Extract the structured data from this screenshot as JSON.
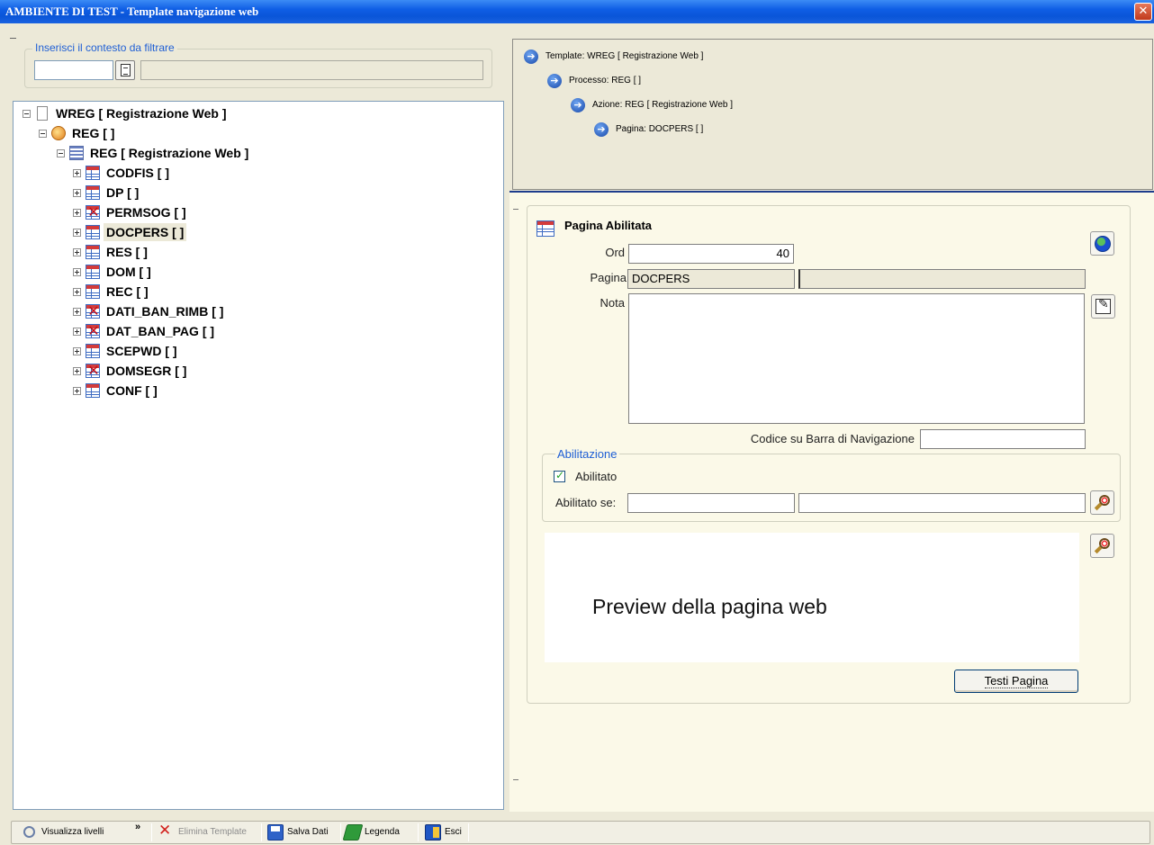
{
  "window": {
    "title": "AMBIENTE DI TEST - Template navigazione web",
    "close_glyph": "✕"
  },
  "filter": {
    "legend": "Inserisci il contesto da filtrare",
    "input_value": "",
    "description_value": ""
  },
  "tree": [
    {
      "label": "WREG  [ Registrazione Web ]",
      "icon": "document-icon",
      "expander": "minus"
    },
    {
      "label": "REG  [ ]",
      "icon": "process-icon",
      "expander": "minus"
    },
    {
      "label": "REG  [ Registrazione Web ]",
      "icon": "action-icon",
      "expander": "minus"
    },
    {
      "label": "CODFIS  [ ]",
      "icon": "table-icon",
      "expander": "plus"
    },
    {
      "label": "DP  [ ]",
      "icon": "table-icon",
      "expander": "plus"
    },
    {
      "label": "PERMSOG  [ ]",
      "icon": "table-disabled-icon",
      "expander": "plus"
    },
    {
      "label": "DOCPERS  [ ]",
      "icon": "table-icon",
      "expander": "plus",
      "selected": true
    },
    {
      "label": "RES  [ ]",
      "icon": "table-icon",
      "expander": "plus"
    },
    {
      "label": "DOM  [ ]",
      "icon": "table-icon",
      "expander": "plus"
    },
    {
      "label": "REC  [ ]",
      "icon": "table-icon",
      "expander": "plus"
    },
    {
      "label": "DATI_BAN_RIMB  [ ]",
      "icon": "table-disabled-icon",
      "expander": "plus"
    },
    {
      "label": "DAT_BAN_PAG  [ ]",
      "icon": "table-disabled-icon",
      "expander": "plus"
    },
    {
      "label": "SCEPWD  [ ]",
      "icon": "table-icon",
      "expander": "plus"
    },
    {
      "label": "DOMSEGR  [ ]",
      "icon": "table-disabled-icon",
      "expander": "plus"
    },
    {
      "label": "CONF  [ ]",
      "icon": "table-icon",
      "expander": "plus"
    }
  ],
  "breadcrumb": [
    {
      "label": "Template: WREG  [ Registrazione Web ]"
    },
    {
      "label": "Processo: REG  [ ]"
    },
    {
      "label": "Azione: REG  [ Registrazione Web ]"
    },
    {
      "label": "Pagina: DOCPERS  [ ]"
    }
  ],
  "detail": {
    "header": "Pagina Abilitata",
    "ord_label": "Ord",
    "ord_value": "40",
    "pagina_label": "Pagina",
    "pagina_value": "DOCPERS",
    "pagina_desc_value": "",
    "nota_label": "Nota",
    "nota_value": "",
    "codice_label": "Codice su Barra di Navigazione",
    "codice_value": ""
  },
  "abilitazione": {
    "legend": "Abilitazione",
    "checkbox_label": "Abilitato",
    "checked": true,
    "condition_label": "Abilitato se:",
    "condition_value": "",
    "condition_desc_value": ""
  },
  "preview": {
    "text": "Preview della pagina web",
    "button_label": "Testi Pagina"
  },
  "toolbar": {
    "visualizza_label": "Visualizza livelli",
    "chevron": "»",
    "elimina_label": "Elimina Template",
    "salva_label": "Salva Dati",
    "legenda_label": "Legenda",
    "esci_label": "Esci"
  },
  "colors": {
    "title_bar": "#0a55d8",
    "accent_blue": "#1f5fd5",
    "panel_bg": "#ece9d8",
    "detail_bg": "#fbf9e8",
    "separator": "#1e3d8c"
  }
}
